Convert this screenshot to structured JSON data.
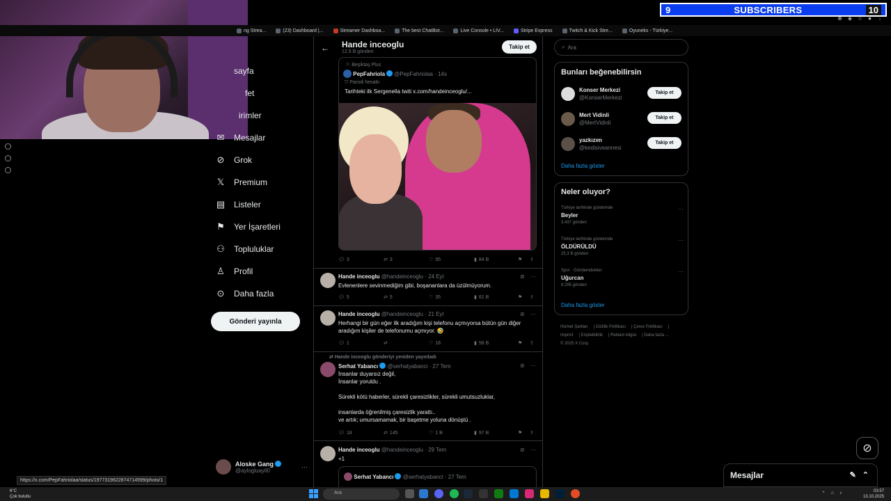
{
  "overlay": {
    "subscribers_current": "9",
    "subscribers_label": "SUBSCRIBERS",
    "subscribers_goal": "10"
  },
  "bookmarks": [
    {
      "label": "ng Strea..."
    },
    {
      "label": "(23) Dashboard |..."
    },
    {
      "label": "Streamer Dashboa..."
    },
    {
      "label": "The best ChatBot..."
    },
    {
      "label": "Live Console • LIV..."
    },
    {
      "label": "Stripe Express"
    },
    {
      "label": "Twitch & Kick Stre..."
    },
    {
      "label": "Oyuneks - Türkiye..."
    }
  ],
  "nav": {
    "items": [
      {
        "label": "sayfa",
        "icon": "home-icon"
      },
      {
        "label": "fet",
        "icon": "search-icon"
      },
      {
        "label": "irimler",
        "icon": "bell-icon"
      },
      {
        "label": "Mesajlar",
        "icon": "mail-icon"
      },
      {
        "label": "Grok",
        "icon": "grok-icon"
      },
      {
        "label": "Premium",
        "icon": "x-logo-icon"
      },
      {
        "label": "Listeler",
        "icon": "list-icon"
      },
      {
        "label": "Yer İşaretleri",
        "icon": "bookmark-icon"
      },
      {
        "label": "Topluluklar",
        "icon": "people-icon"
      },
      {
        "label": "Profil",
        "icon": "person-icon"
      },
      {
        "label": "Daha fazla",
        "icon": "more-circle-icon"
      }
    ],
    "post_button": "Gönderi yayınla",
    "account": {
      "name": "Aloske Gang",
      "handle": "@aylogluayil0"
    }
  },
  "profile": {
    "name": "Hande inceoglu",
    "post_count": "12,9 B gönderi",
    "follow_label": "Takip et"
  },
  "quote": {
    "context": "Beşiktaş Plus",
    "name": "PepFahriola",
    "handle": "@PepFahriolaa",
    "time": "· 14s",
    "parody": "Parodi hesabı",
    "text": "Tarihteki ilk Sergenella twiti  x.com/handeinceoglu/..."
  },
  "tweets": [
    {
      "actions": {
        "replies": "3",
        "reposts": "3",
        "likes": "95",
        "views": "84 B"
      }
    },
    {
      "name": "Hande inceoglu",
      "handle": "@handeinceoglu",
      "time": "· 24 Eyl",
      "text": "Evlenenlere sevinmediğim gibi, boşananlara da üzülmüyorum.",
      "actions": {
        "replies": "5",
        "reposts": "5",
        "likes": "35",
        "views": "61 B"
      }
    },
    {
      "name": "Hande inceoglu",
      "handle": "@handeinceoglu",
      "time": "· 21 Eyl",
      "text": "Herhangi bir gün eğer ilk aradığım kişi telefonu açmıyorsa bütün gün diğer\naradığım kişiler de telefonumu açmıyor. 🤣",
      "actions": {
        "replies": "1",
        "reposts": "",
        "likes": "18",
        "views": "58 B"
      }
    },
    {
      "repost_context": "Hande inceoglu gönderiyi yeniden yayınladı",
      "name": "Serhat Yabancı",
      "handle": "@serhatyabanci",
      "time": "· 27 Tem",
      "text": "İnsanlar duyarsız değil,\nİnsanlar yoruldu .\n\nSürekli kötü haberler, sürekli çaresizlikler, sürekli umutsuzluklar,\n\ninsanlarda öğrenilmiş çaresizlik yarattı..\n ve artık; umursamamak, bir başetme yoluna dönüştü .",
      "actions": {
        "replies": "18",
        "reposts": "145",
        "likes": "1 B",
        "views": "97 B"
      }
    },
    {
      "name": "Hande inceoglu",
      "handle": "@handeinceoglu",
      "time": "· 29 Tem",
      "text": "+1",
      "quoted": {
        "name": "Serhat Yabancı",
        "handle": "@serhatyabanci",
        "time": "· 27 Tem"
      }
    }
  ],
  "right": {
    "search_placeholder": "Ara",
    "suggest_title": "Bunları beğenebilirsin",
    "suggestions": [
      {
        "name": "Konser Merkezi",
        "handle": "@KonserMerkezi",
        "button": "Takip et"
      },
      {
        "name": "Mert Vidinli",
        "handle": "@MertVidinli",
        "button": "Takip et"
      },
      {
        "name": "yazkızım",
        "handle": "@kedisiveannesi",
        "button": "Takip et"
      }
    ],
    "show_more": "Daha fazla göster",
    "trends_title": "Neler oluyor?",
    "trends": [
      {
        "context": "Türkiye tarihinde gündemde",
        "title": "Beyler",
        "count": "3.437 gönderi"
      },
      {
        "context": "Türkiye tarihinde gündemde",
        "title": "ÖLDÜRÜLDÜ",
        "count": "25,3 B gönderi"
      },
      {
        "context": "Spor · Gündemdekiler",
        "title": "Uğurcan",
        "count": "8.295 gönderi"
      }
    ],
    "trends_more": "Daha fazla göster",
    "footer": [
      "Hizmet Şartları",
      "Gizlilik Politikası",
      "Çerez Politikası",
      "Imprint",
      "Erişilebilirlik",
      "Reklam bilgisi",
      "Daha fazla ...",
      "© 2025 X Corp."
    ]
  },
  "messages_dock": {
    "label": "Mesajlar"
  },
  "status_url": "https://x.com/PepFahriolaa/status/1977319622874714599/photo/1",
  "taskbar": {
    "weather_temp": "6°C",
    "weather_desc": "Çok bulutlu",
    "search_label": "Ara",
    "time": "03:57",
    "date": "13.10.2025"
  },
  "colors": {
    "accent": "#1d9bf0",
    "subs_bar": "#0a3df0",
    "background": "#000000"
  }
}
